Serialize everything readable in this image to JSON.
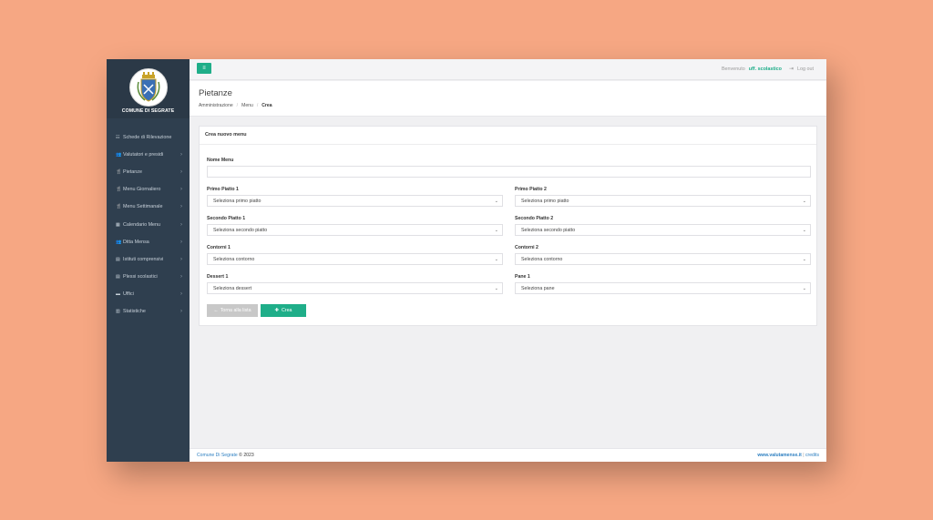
{
  "sidebar": {
    "brand_name": "COMUNE DI SEGRATE",
    "items": [
      {
        "label": "Schede di Rilevazione",
        "icon": "grid-icon",
        "glyph": "☷",
        "chevron": ""
      },
      {
        "label": "Valutatori e presidi",
        "icon": "users-icon",
        "glyph": "👥",
        "chevron": "›"
      },
      {
        "label": "Pietanze",
        "icon": "cutlery-icon",
        "glyph": "🍴",
        "chevron": "›"
      },
      {
        "label": "Menu Giornaliero",
        "icon": "cutlery-icon",
        "glyph": "🍴",
        "chevron": "›"
      },
      {
        "label": "Menu Settimanale",
        "icon": "cutlery-icon",
        "glyph": "🍴",
        "chevron": "›"
      },
      {
        "label": "Calendario Menu",
        "icon": "calendar-icon",
        "glyph": "▦",
        "chevron": "›"
      },
      {
        "label": "Ditta Mensa",
        "icon": "users-icon",
        "glyph": "👥",
        "chevron": "›"
      },
      {
        "label": "Istituti comprensivi",
        "icon": "building-icon",
        "glyph": "▤",
        "chevron": "›"
      },
      {
        "label": "Plessi scolastici",
        "icon": "building-icon",
        "glyph": "▤",
        "chevron": "›"
      },
      {
        "label": "Uffici",
        "icon": "folder-icon",
        "glyph": "▬",
        "chevron": "›"
      },
      {
        "label": "Statistiche",
        "icon": "bar-chart-icon",
        "glyph": "▥",
        "chevron": "›"
      }
    ]
  },
  "topbar": {
    "menu_glyph": "≡",
    "welcome": "Benvenuto",
    "user": "uff. scolastico",
    "logout": "Log out",
    "logout_glyph": "⇥"
  },
  "header": {
    "title": "Pietanze",
    "breadcrumb": [
      "Amministrazione",
      "Menu",
      "Crea"
    ],
    "separator": "/"
  },
  "form": {
    "title": "Crea nuovo menu",
    "nome_label": "Nome Menu",
    "nome_value": "",
    "chevron": "⌄",
    "left": [
      {
        "label": "Primo Piatto 1",
        "selected": "Seleziona primo piatto"
      },
      {
        "label": "Secondo Piatto 1",
        "selected": "Seleziona secondo piatto"
      },
      {
        "label": "Contorni 1",
        "selected": "Seleziona contorno"
      },
      {
        "label": "Dessert 1",
        "selected": "Seleziona dessert"
      }
    ],
    "right": [
      {
        "label": "Primo Piatto 2",
        "selected": "Seleziona primo piatto"
      },
      {
        "label": "Secondo Piatto 2",
        "selected": "Seleziona secondo piatto"
      },
      {
        "label": "Contorni 2",
        "selected": "Seleziona contorno"
      },
      {
        "label": "Pane 1",
        "selected": "Seleziona pane"
      }
    ],
    "back_label": "Torna alla lista",
    "back_glyph": "←",
    "create_label": "Crea",
    "create_glyph": "✚"
  },
  "footer": {
    "org": "Comune Di Segrate",
    "copyright": "© 2023",
    "site": "www.valutamense.it",
    "divider": "|",
    "credits": "credits"
  },
  "colors": {
    "accent": "#1fae89",
    "sidebar": "#2f3f4f",
    "background": "#f6a783"
  }
}
